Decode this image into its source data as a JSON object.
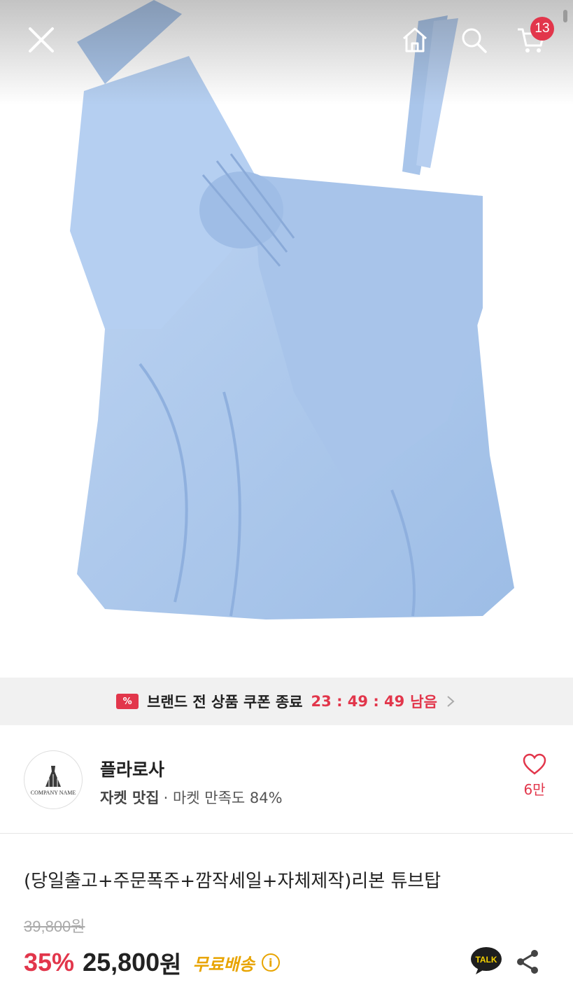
{
  "header": {
    "cart_count": "13"
  },
  "icons": {
    "close": "close-icon",
    "home": "home-icon",
    "search": "search-icon",
    "cart": "cart-icon",
    "coupon": "coupon-icon",
    "chevron": "chevron-right-icon",
    "heart": "heart-icon",
    "info": "info-icon",
    "talk": "kakao-talk-icon",
    "share": "share-icon"
  },
  "coupon_banner": {
    "badge": "%",
    "text": "브랜드 전 상품 쿠폰 종료",
    "timer": "23 : 49 : 49",
    "suffix": "남음"
  },
  "seller": {
    "logo_text": "COMPANY NAME",
    "name": "플라로사",
    "category": "자켓 맛집",
    "satisfaction": "· 마켓 만족도 84%",
    "favorites": "6만"
  },
  "product": {
    "title": "(당일출고+주문폭주+깜작세일+자체제작)리본 튜브탑",
    "original_price": "39,800원",
    "discount": "35%",
    "price": "25,800",
    "price_unit": "원",
    "shipping": "무료배송",
    "info_glyph": "i",
    "talk_label": "TALK"
  },
  "colors": {
    "accent": "#e2364b",
    "shipping": "#e8a400",
    "product_fabric": "#aec9ec"
  }
}
